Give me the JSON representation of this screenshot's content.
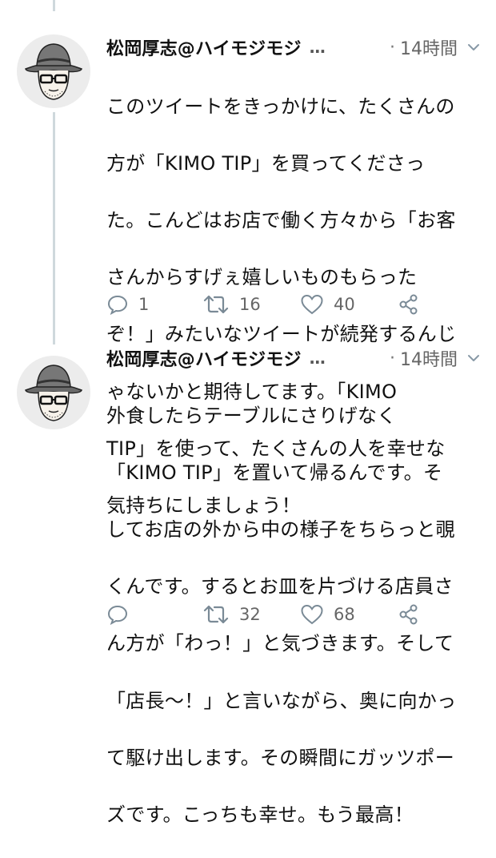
{
  "tweets": [
    {
      "author": "松岡厚志@ハイモジモジ",
      "ellipsis": "…",
      "dot": "·",
      "time": "14時間",
      "lines": [
        "このツイートをきっかけに、たくさんの",
        "方が「KIMO TIP」を買ってくださっ",
        "た。こんどはお店で働く方々から「お客",
        "さんからすげぇ嬉しいものもらった",
        "ぞ！」みたいなツイートが続発するんじ",
        "ゃないかと期待してます。「KIMO",
        "TIP」を使って、たくさんの人を幸せな",
        "気持ちにしましょう！"
      ],
      "reply_count": "1",
      "retweet_count": "16",
      "like_count": "40"
    },
    {
      "author": "松岡厚志@ハイモジモジ",
      "ellipsis": "…",
      "dot": "·",
      "time": "14時間",
      "lines": [
        "外食したらテーブルにさりげなく",
        "「KIMO TIP」を置いて帰るんです。そ",
        "してお店の外から中の様子をちらっと覗",
        "くんです。するとお皿を片づける店員さ",
        "ん方が「わっ！」と気づきます。そして",
        "「店長〜！」と言いながら、奥に向かっ",
        "て駆け出します。その瞬間にガッツポー",
        "ズです。こっちも幸せ。もう最高！"
      ],
      "reply_count": "",
      "retweet_count": "32",
      "like_count": "68"
    }
  ],
  "icons": {
    "reply": "reply-icon",
    "retweet": "retweet-icon",
    "like": "heart-icon",
    "share": "share-icon",
    "menu": "chevron-down-icon",
    "avatar": "avatar-illustration"
  },
  "colors": {
    "thread_line": "#cfd8dc",
    "meta_text": "#666666",
    "body_text": "#111111"
  }
}
